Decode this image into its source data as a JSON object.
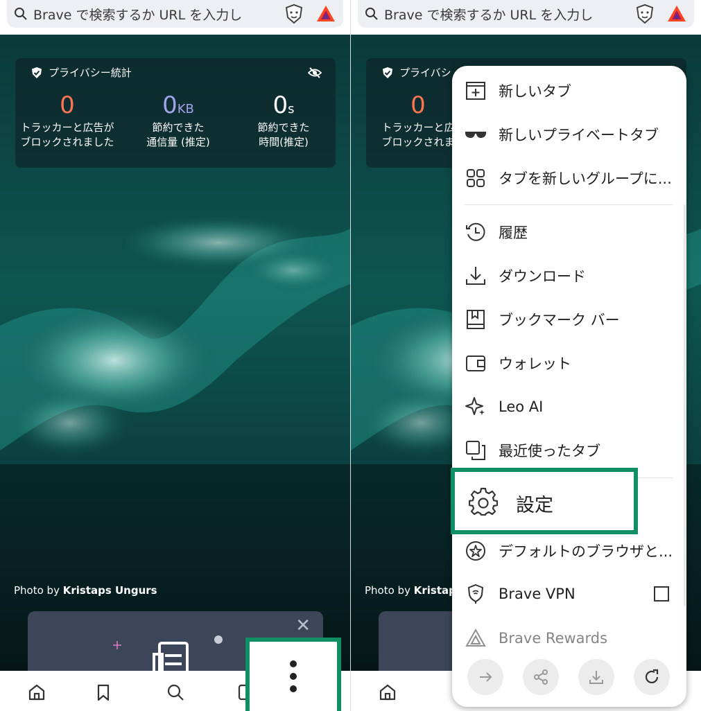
{
  "search": {
    "placeholder": "Brave で検索するか URL を入力し"
  },
  "privacy": {
    "title": "プライバシー統計",
    "stats": [
      {
        "value": "0",
        "unit": "",
        "label": "トラッカーと広告が\nブロックされました",
        "color": "#ff7654"
      },
      {
        "value": "0",
        "unit": "KB",
        "label": "節約できた\n通信量 (推定)",
        "color": "#a0a5eb"
      },
      {
        "value": "0",
        "unit": "s",
        "label": "節約できた\n時間(推定)",
        "color": "#ffffff"
      }
    ]
  },
  "photo_credit": {
    "prefix": "Photo by ",
    "author": "Kristaps Ungurs"
  },
  "right_credit": {
    "prefix": "Photo by ",
    "author": "Kristaps"
  },
  "right_stats_partial": {
    "title": "プライバシ",
    "value": "0",
    "label": "トラッカーと広\nブロックされま"
  },
  "menu": {
    "items": [
      {
        "label": "新しいタブ",
        "icon": "new-tab-icon"
      },
      {
        "label": "新しいプライベートタブ",
        "icon": "private-tab-icon"
      },
      {
        "label": "タブを新しいグループに...",
        "icon": "tab-group-icon"
      },
      {
        "label": "履歴",
        "icon": "history-icon"
      },
      {
        "label": "ダウンロード",
        "icon": "download-icon"
      },
      {
        "label": "ブックマーク バー",
        "icon": "bookmark-icon"
      },
      {
        "label": "ウォレット",
        "icon": "wallet-icon"
      },
      {
        "label": "Leo AI",
        "icon": "leo-ai-icon"
      },
      {
        "label": "最近使ったタブ",
        "icon": "recent-tabs-icon"
      },
      {
        "label": "設定",
        "icon": "gear-icon"
      },
      {
        "label": "デフォルトのブラウザと...",
        "icon": "default-browser-icon"
      },
      {
        "label": "Brave VPN",
        "icon": "vpn-icon"
      },
      {
        "label": "Brave Rewards",
        "icon": "rewards-icon"
      }
    ],
    "actions": [
      "forward-icon",
      "share-icon",
      "download-page-icon",
      "reload-icon"
    ]
  },
  "colors": {
    "highlight": "#0f8f63",
    "accent_orange": "#ff7654",
    "accent_purple": "#a0a5eb"
  }
}
